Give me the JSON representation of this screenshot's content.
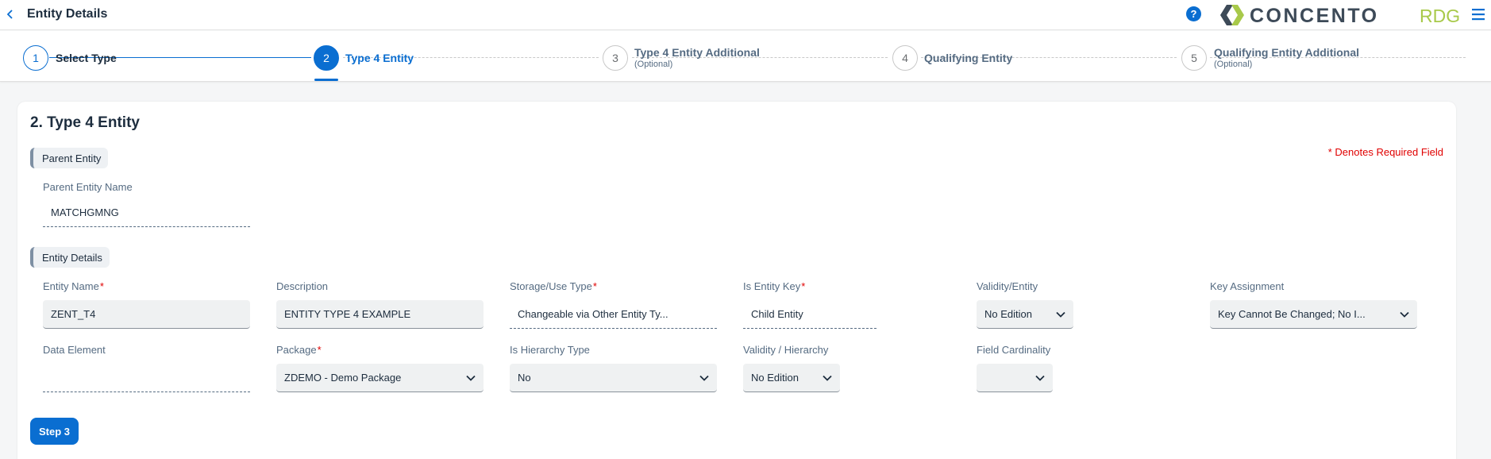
{
  "header": {
    "title": "Entity Details",
    "help_glyph": "?",
    "logo": {
      "brand": "CONCENTO",
      "suffix": "RDG",
      "brand_color": "#3d4a58",
      "suffix_color": "#a8c94a"
    }
  },
  "wizard": {
    "steps": [
      {
        "number": "1",
        "label": "Select Type",
        "sub": "",
        "state": "done"
      },
      {
        "number": "2",
        "label": "Type 4 Entity",
        "sub": "",
        "state": "active"
      },
      {
        "number": "3",
        "label": "Type 4 Entity Additional",
        "sub": "(Optional)",
        "state": "todo"
      },
      {
        "number": "4",
        "label": "Qualifying Entity",
        "sub": "",
        "state": "todo"
      },
      {
        "number": "5",
        "label": "Qualifying Entity Additional",
        "sub": "(Optional)",
        "state": "todo"
      }
    ],
    "accent_color": "#0a6ed1"
  },
  "form": {
    "section_title": "2. Type 4 Entity",
    "required_note": "* Denotes Required Field",
    "required_mark": "*",
    "parent_group": {
      "title": "Parent Entity",
      "parent_entity_name": {
        "label": "Parent Entity Name",
        "value": "MATCHGMNG"
      }
    },
    "details_group": {
      "title": "Entity Details",
      "entity_name": {
        "label": "Entity Name",
        "value": "ZENT_T4"
      },
      "description": {
        "label": "Description",
        "value": "ENTITY TYPE 4 EXAMPLE"
      },
      "storage_use_type": {
        "label": "Storage/Use Type",
        "value": "Changeable via Other Entity Ty..."
      },
      "is_entity_key": {
        "label": "Is Entity Key",
        "value": "Child Entity"
      },
      "validity_entity": {
        "label": "Validity/Entity",
        "value": "No Edition"
      },
      "key_assignment": {
        "label": "Key Assignment",
        "value": "Key Cannot Be Changed; No I..."
      },
      "data_element": {
        "label": "Data Element",
        "value": ""
      },
      "package": {
        "label": "Package",
        "value": "ZDEMO - Demo Package"
      },
      "is_hierarchy_type": {
        "label": "Is Hierarchy Type",
        "value": "No"
      },
      "validity_hierarchy": {
        "label": "Validity / Hierarchy",
        "value": "No Edition"
      },
      "field_cardinality": {
        "label": "Field Cardinality",
        "value": ""
      }
    },
    "next_button": "Step 3"
  }
}
